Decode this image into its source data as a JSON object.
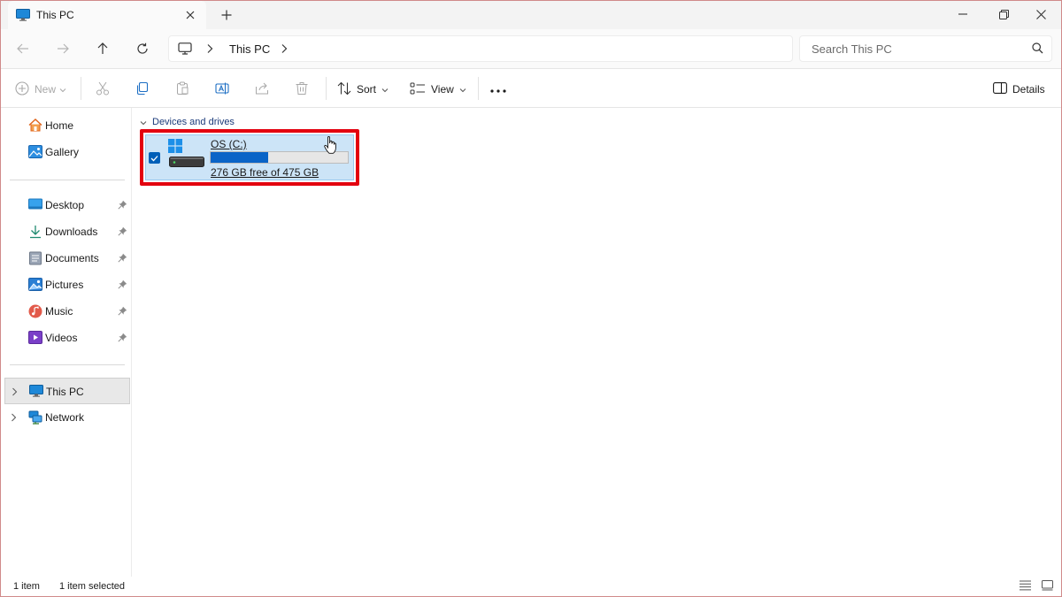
{
  "window": {
    "tab_title": "This PC",
    "tab_icon": "monitor-icon",
    "new_tab_icon": "plus-icon"
  },
  "nav": {
    "address_crumb": "This PC",
    "search_placeholder": "Search This PC"
  },
  "toolbar": {
    "new_label": "New",
    "sort_label": "Sort",
    "view_label": "View",
    "details_label": "Details"
  },
  "sidebar": {
    "top": [
      {
        "label": "Home",
        "icon": "home-icon"
      },
      {
        "label": "Gallery",
        "icon": "gallery-icon"
      }
    ],
    "pinned": [
      {
        "label": "Desktop",
        "icon": "desktop-folder-icon"
      },
      {
        "label": "Downloads",
        "icon": "downloads-icon"
      },
      {
        "label": "Documents",
        "icon": "documents-icon"
      },
      {
        "label": "Pictures",
        "icon": "pictures-icon"
      },
      {
        "label": "Music",
        "icon": "music-icon"
      },
      {
        "label": "Videos",
        "icon": "videos-icon"
      }
    ],
    "locations": [
      {
        "label": "This PC",
        "icon": "monitor-icon",
        "selected": true
      },
      {
        "label": "Network",
        "icon": "network-icon",
        "selected": false
      }
    ]
  },
  "content": {
    "group_label": "Devices and drives",
    "drive": {
      "name": "OS (C:)",
      "free_text": "276 GB free of 475 GB",
      "used_fraction": 0.419,
      "selected": true
    }
  },
  "status": {
    "item_count": "1 item",
    "selected_count": "1 item selected"
  },
  "colors": {
    "accent": "#005fb8",
    "selection": "#cce4f7",
    "highlight_box": "#e3000f",
    "capacity_bar": "#0a64c7"
  }
}
